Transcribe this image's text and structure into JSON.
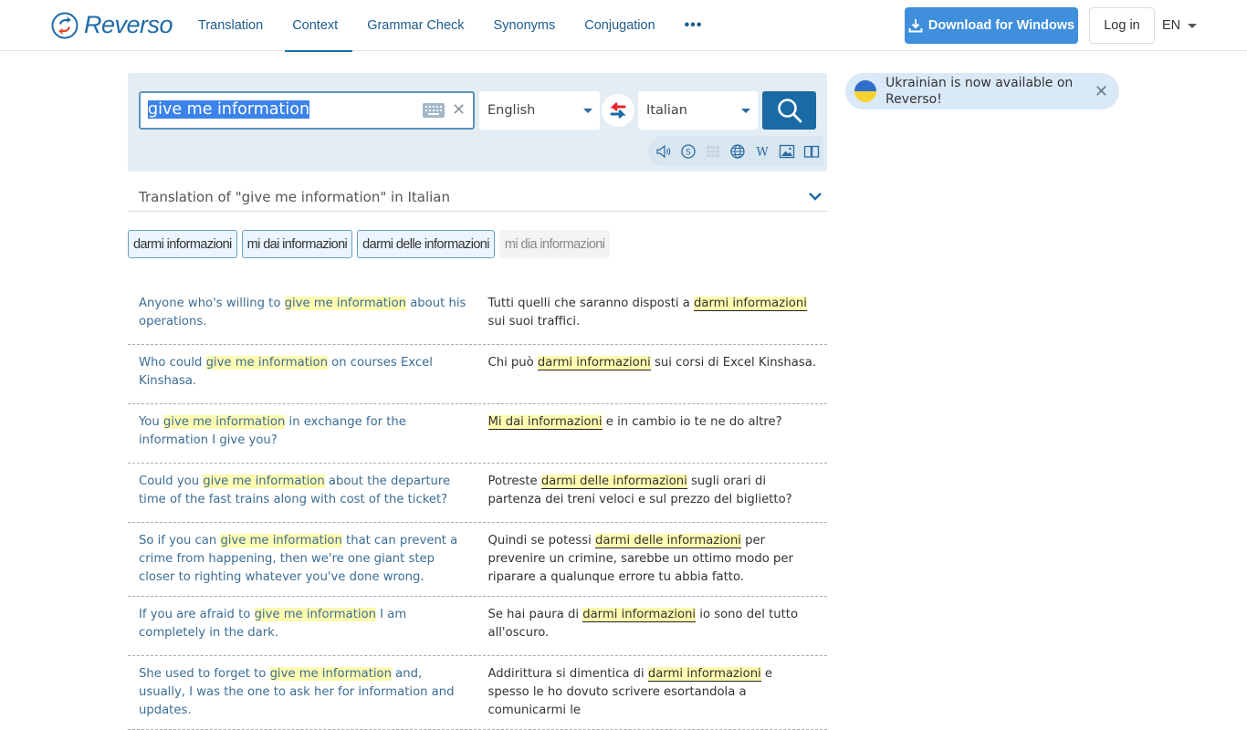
{
  "header": {
    "logo_text": "Reverso",
    "nav": [
      {
        "label": "Translation",
        "active": false
      },
      {
        "label": "Context",
        "active": true
      },
      {
        "label": "Grammar Check",
        "active": false
      },
      {
        "label": "Synonyms",
        "active": false
      },
      {
        "label": "Conjugation",
        "active": false
      }
    ],
    "more_label": "•••",
    "download_label": "Download for Windows",
    "login_label": "Log in",
    "ui_language": "EN"
  },
  "search": {
    "query": "give me information",
    "source_language": "English",
    "target_language": "Italian",
    "tools": [
      "speaker-icon",
      "synonyms-icon",
      "grid-icon",
      "globe-icon",
      "wikipedia-icon",
      "image-icon",
      "dictionary-icon"
    ]
  },
  "banner": {
    "text": "Ukrainian is now available on Reverso!",
    "flag_colors": [
      "#2f6fcb",
      "#f5d230"
    ]
  },
  "translation": {
    "title": "Translation of \"give me information\" in Italian",
    "chips": [
      {
        "label": "darmi informazioni",
        "style": "primary"
      },
      {
        "label": "mi dai informazioni",
        "style": "primary"
      },
      {
        "label": "darmi delle informazioni",
        "style": "primary"
      },
      {
        "label": "mi dia informazioni",
        "style": "light"
      }
    ]
  },
  "examples": [
    {
      "src": [
        "Anyone who's willing to ",
        "give me information",
        " about his operations."
      ],
      "trg": [
        "Tutti quelli che saranno disposti a ",
        "darmi informazioni",
        " sui suoi traffici."
      ]
    },
    {
      "src": [
        "Who could ",
        "give me information",
        " on courses Excel Kinshasa."
      ],
      "trg": [
        "Chi può ",
        "darmi informazioni",
        " sui corsi di Excel Kinshasa."
      ]
    },
    {
      "src": [
        "You ",
        "give me information",
        " in exchange for the information I give you?"
      ],
      "trg": [
        "",
        "Mi dai informazioni",
        " e in cambio io te ne do altre?"
      ]
    },
    {
      "src": [
        "Could you ",
        "give me information",
        " about the departure time of the fast trains along with cost of the ticket?"
      ],
      "trg": [
        "Potreste ",
        "darmi delle informazioni",
        " sugli orari di partenza dei treni veloci e sul prezzo del biglietto?"
      ]
    },
    {
      "src": [
        "So if you can ",
        "give me information",
        " that can prevent a crime from happening, then we're one giant step closer to righting whatever you've done wrong."
      ],
      "trg": [
        "Quindi se potessi ",
        "darmi delle informazioni",
        " per prevenire un crimine, sarebbe un ottimo modo per riparare a qualunque errore tu abbia fatto."
      ]
    },
    {
      "src": [
        "If you are afraid to ",
        "give me information",
        " I am completely in the dark."
      ],
      "trg": [
        "Se hai paura di ",
        "darmi informazioni",
        " io sono del tutto all'oscuro."
      ]
    },
    {
      "src": [
        "She used to forget to ",
        "give me information",
        " and, usually, I was the one to ask her for information and updates."
      ],
      "trg": [
        "Addirittura si dimentica di ",
        "darmi informazioni",
        " e spesso le ho dovuto scrivere esortandola a comunicarmi le"
      ]
    }
  ],
  "colors": {
    "brand_blue": "#1a6aa3",
    "download_blue": "#3f8fdc",
    "highlight": "#fffbb0",
    "panel_bg": "#e4edf3"
  }
}
